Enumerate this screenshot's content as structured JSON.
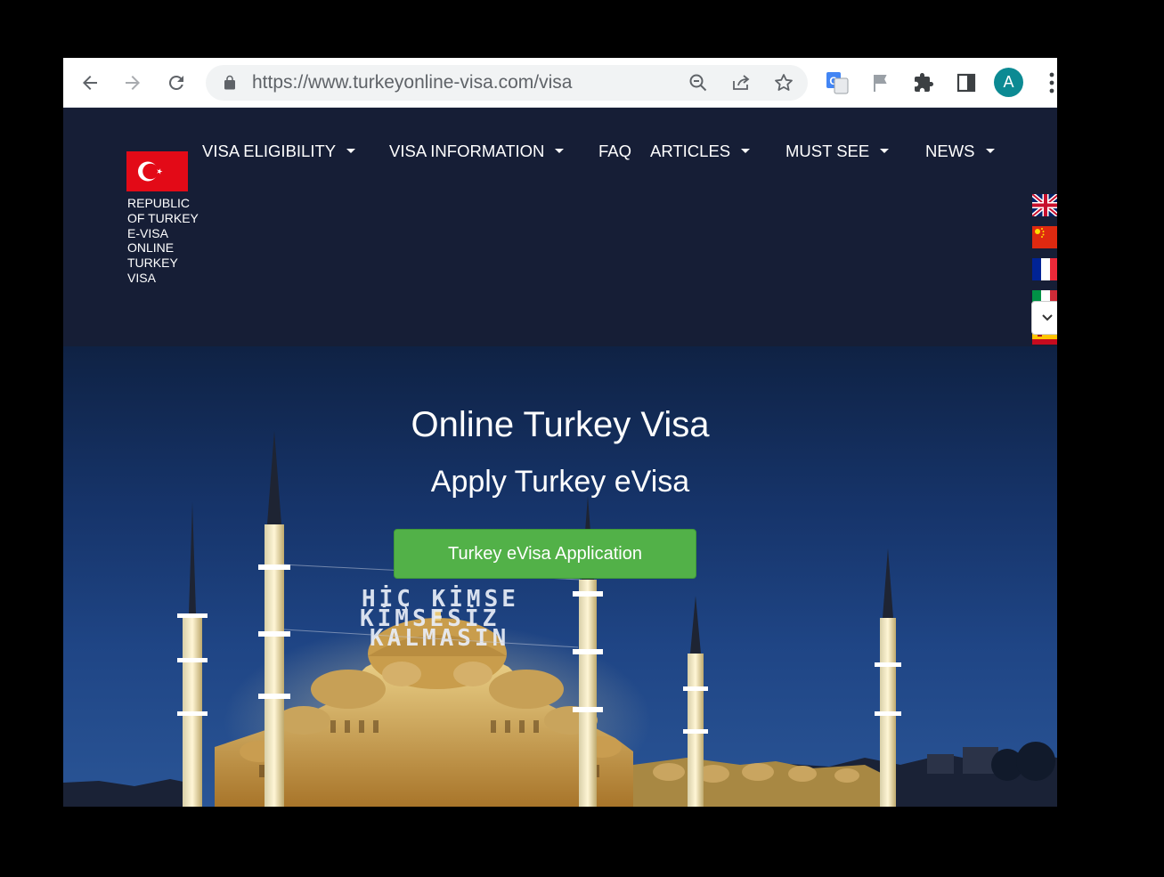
{
  "browser": {
    "url_base": "https://www.turkeyonline-visa.com",
    "url_path": "/visa",
    "avatar_letter": "A",
    "icons": [
      "back-icon",
      "forward-icon",
      "reload-icon",
      "lock-icon",
      "zoom-out-icon",
      "share-icon",
      "star-icon",
      "translate-icon",
      "flag-icon",
      "extensions-icon",
      "side-panel-icon",
      "kebab-menu-icon"
    ]
  },
  "site": {
    "brand_text": "REPUBLIC OF TURKEY E-VISA ONLINE TURKEY VISA",
    "nav": [
      {
        "label": "VISA ELIGIBILITY",
        "dropdown": true
      },
      {
        "label": "VISA INFORMATION",
        "dropdown": true
      },
      {
        "label": "FAQ",
        "dropdown": false
      },
      {
        "label": "ARTICLES",
        "dropdown": true
      },
      {
        "label": "MUST SEE",
        "dropdown": true
      },
      {
        "label": "NEWS",
        "dropdown": true
      }
    ],
    "languages": [
      "English",
      "Chinese",
      "French",
      "Italian",
      "Spanish"
    ],
    "colors": {
      "header_bg": "#161e36",
      "cta_bg": "#52b148",
      "flag_red": "#e30a17"
    }
  },
  "hero": {
    "title": "Online Turkey Visa",
    "subtitle": "Apply Turkey eVisa",
    "cta_label": "Turkey eVisa Application",
    "mahya_lines": [
      "HİÇ KİMSE",
      "KİMSESİZ",
      "KALMASIN"
    ]
  }
}
